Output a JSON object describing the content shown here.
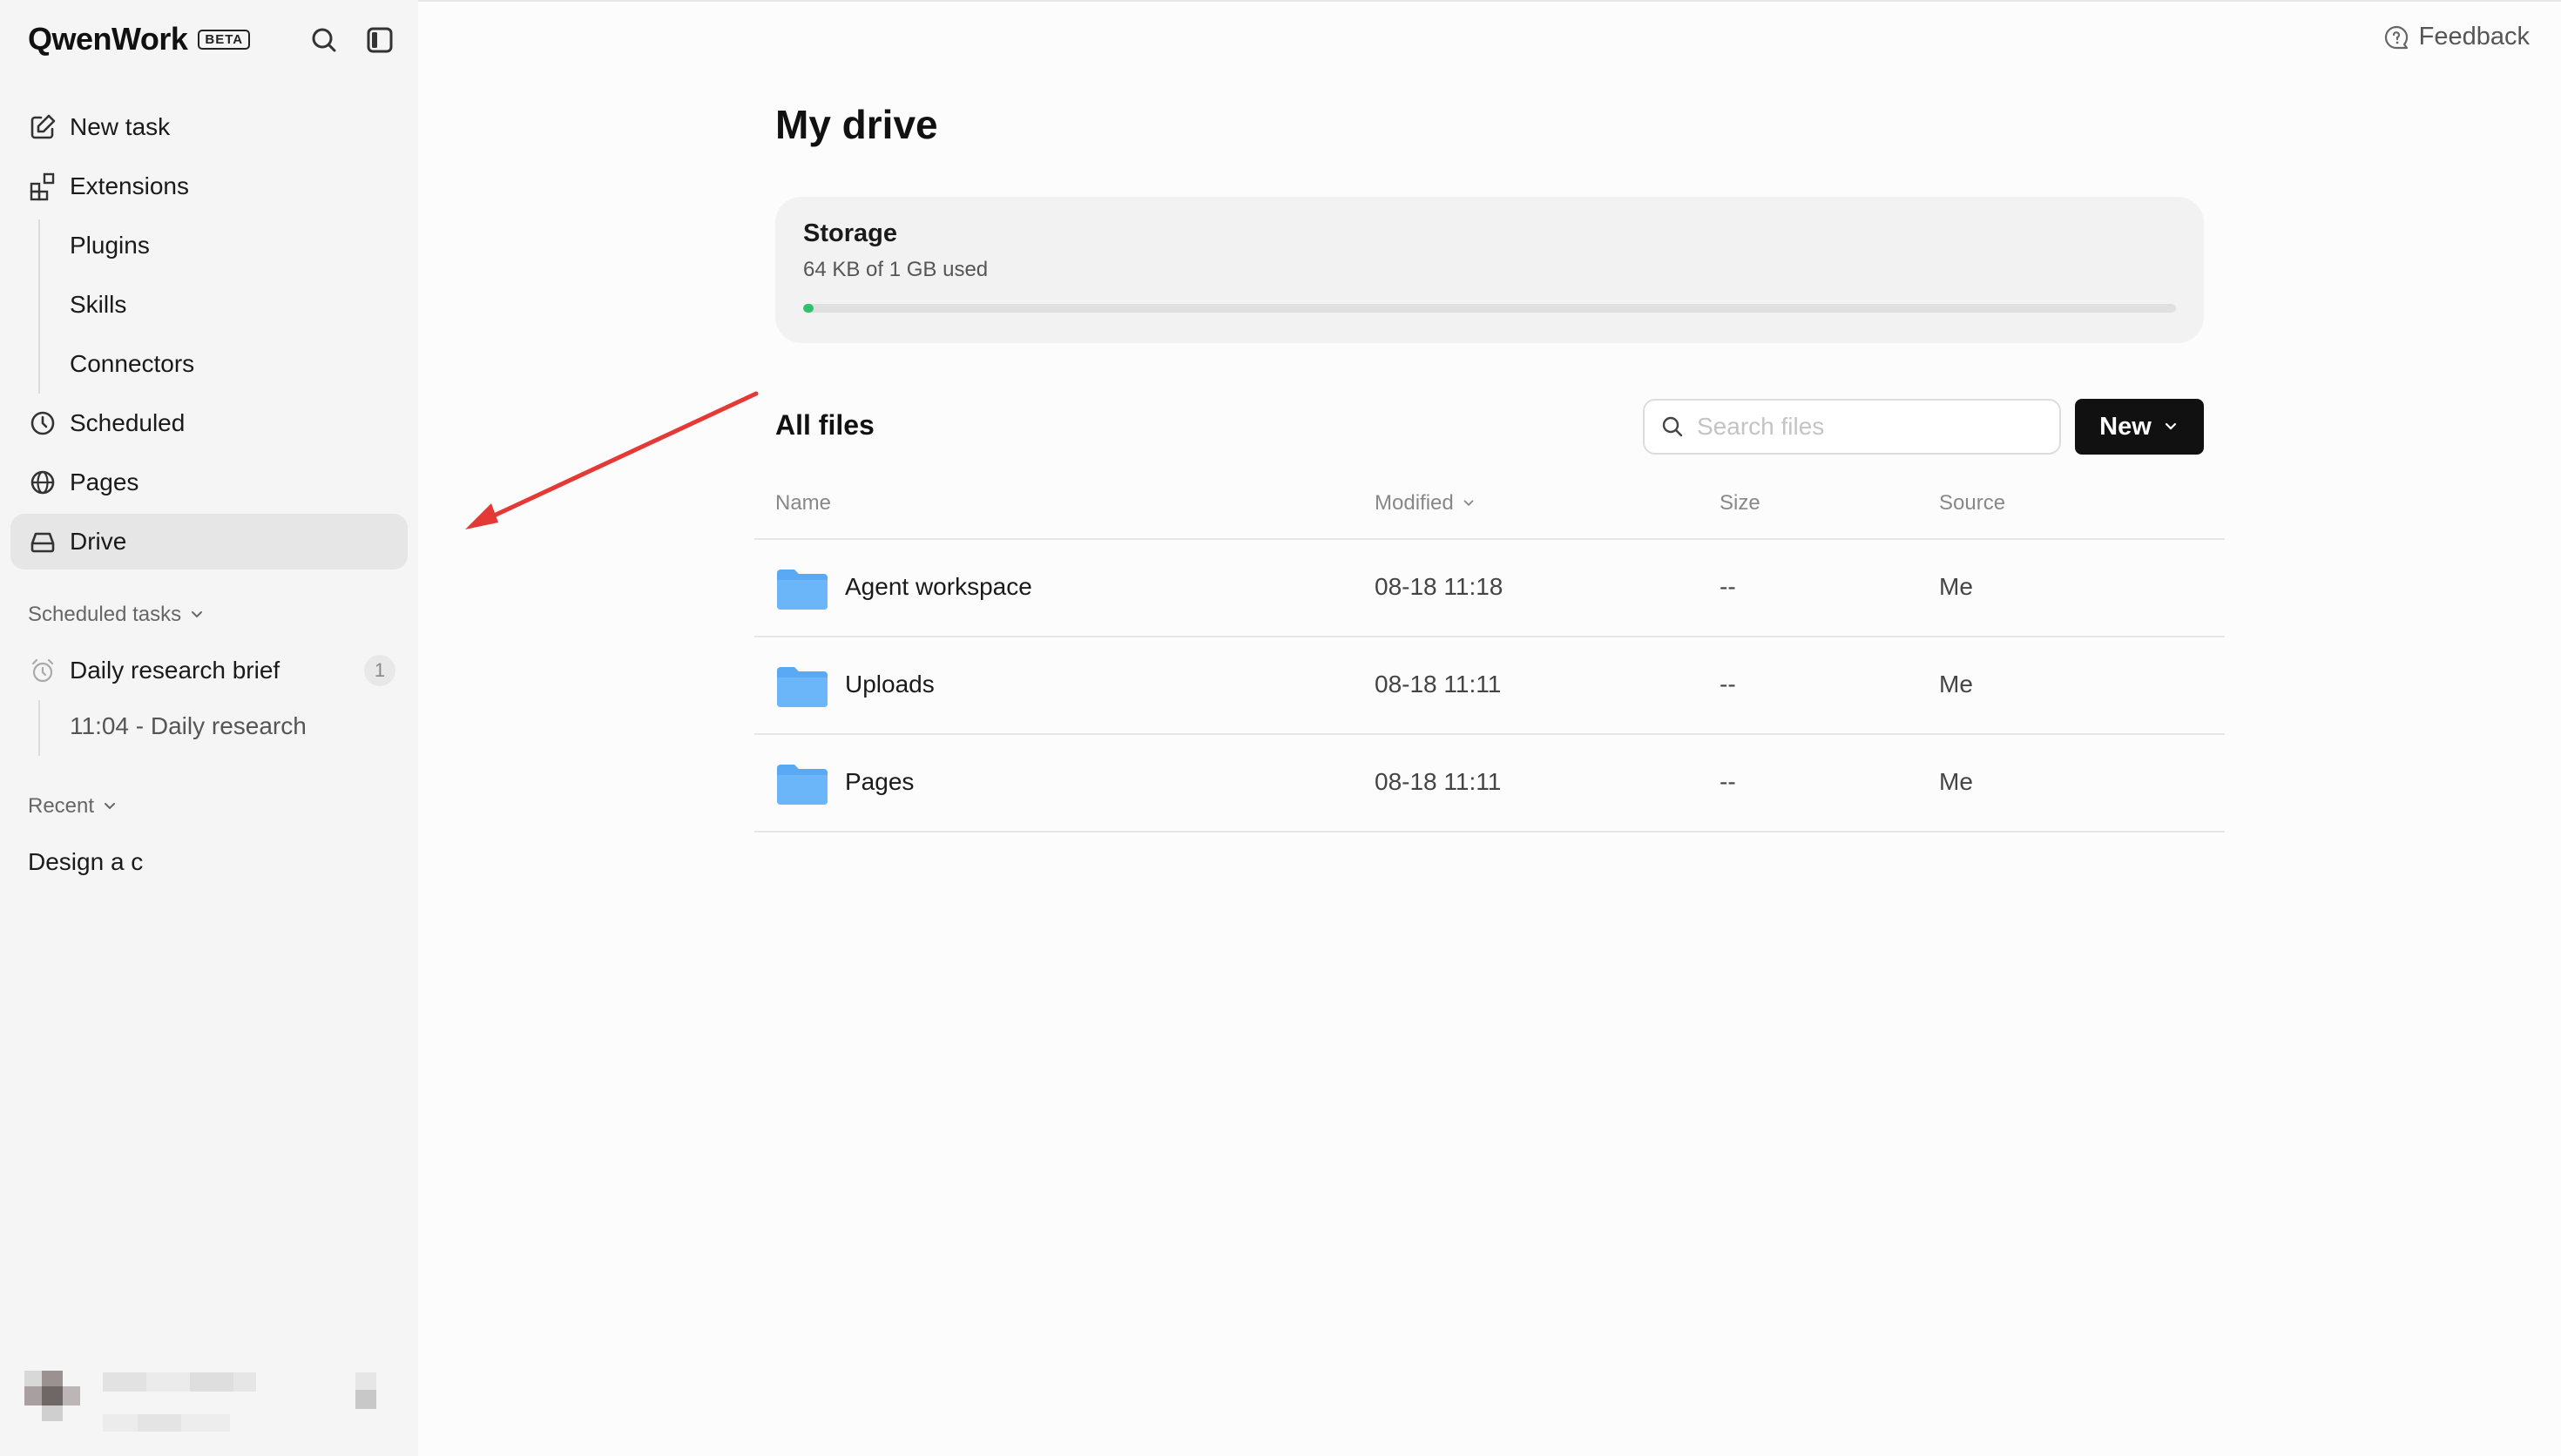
{
  "app": {
    "name": "QwenWork",
    "badge": "BETA"
  },
  "sidebar": {
    "nav": [
      {
        "label": "New task",
        "icon": "edit-icon"
      },
      {
        "label": "Extensions",
        "icon": "extensions-icon"
      },
      {
        "label": "Plugins"
      },
      {
        "label": "Skills"
      },
      {
        "label": "Connectors"
      },
      {
        "label": "Scheduled",
        "icon": "clock-icon"
      },
      {
        "label": "Pages",
        "icon": "globe-icon"
      },
      {
        "label": "Drive",
        "icon": "drive-icon",
        "active": true
      }
    ],
    "scheduled_tasks": {
      "heading": "Scheduled tasks",
      "task": {
        "label": "Daily research brief",
        "count": "1",
        "icon": "alarm-icon"
      },
      "run": "11:04 - Daily research"
    },
    "recent": {
      "heading": "Recent",
      "items": [
        "Design a c"
      ]
    }
  },
  "header": {
    "feedback": "Feedback"
  },
  "main": {
    "title": "My drive",
    "storage": {
      "title": "Storage",
      "used": "64 KB of 1 GB used",
      "fraction": 0.0001,
      "color": "#2ec26a"
    },
    "files": {
      "heading": "All files",
      "search_placeholder": "Search files",
      "new_label": "New",
      "columns": [
        "Name",
        "Modified",
        "Size",
        "Source"
      ],
      "rows": [
        {
          "name": "Agent workspace",
          "modified": "08-18 11:18",
          "size": "--",
          "source": "Me"
        },
        {
          "name": "Uploads",
          "modified": "08-18 11:11",
          "size": "--",
          "source": "Me"
        },
        {
          "name": "Pages",
          "modified": "08-18 11:11",
          "size": "--",
          "source": "Me"
        }
      ]
    }
  },
  "colors": {
    "accent_arrow": "#e53935",
    "folder": "#5aa9f5"
  }
}
